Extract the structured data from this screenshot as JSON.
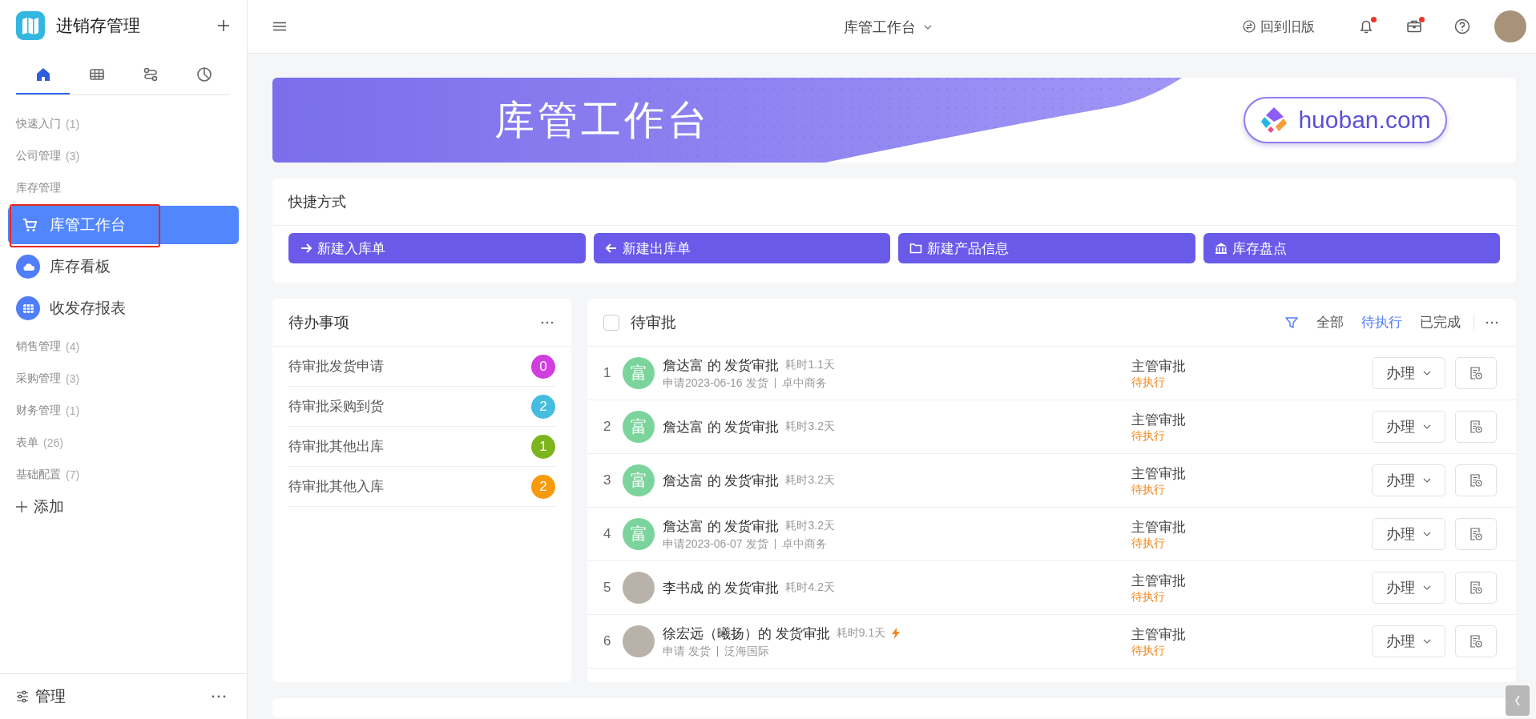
{
  "app": {
    "title": "进销存管理"
  },
  "sidebar": {
    "tabs": [
      {
        "kind": "home",
        "selected": true
      },
      {
        "kind": "table",
        "selected": false
      },
      {
        "kind": "flow",
        "selected": false
      },
      {
        "kind": "chart",
        "selected": false
      }
    ],
    "items": [
      {
        "kind": "section",
        "label": "快速入门",
        "count": "(1)"
      },
      {
        "kind": "section",
        "label": "公司管理",
        "count": "(3)"
      },
      {
        "kind": "section",
        "label": "库存管理"
      },
      {
        "kind": "app-cart",
        "label": "库管工作台",
        "selected": true,
        "highlighted": true
      },
      {
        "kind": "app-cloud",
        "label": "库存看板",
        "selected": false,
        "highlighted": false
      },
      {
        "kind": "app-grid",
        "label": "收发存报表",
        "selected": false,
        "highlighted": false
      },
      {
        "kind": "section",
        "label": "销售管理",
        "count": "(4)"
      },
      {
        "kind": "section",
        "label": "采购管理",
        "count": "(3)"
      },
      {
        "kind": "section",
        "label": "财务管理",
        "count": "(1)"
      },
      {
        "kind": "section",
        "label": "表单",
        "count": "(26)"
      },
      {
        "kind": "section",
        "label": "基础配置",
        "count": "(7)"
      }
    ],
    "add": "添加",
    "footer": "管理"
  },
  "topbar": {
    "title": "库管工作台",
    "old_version": "回到旧版",
    "notifications": [
      {
        "kind": "bell",
        "dot": true
      },
      {
        "kind": "briefcase",
        "dot": true
      },
      {
        "kind": "help"
      }
    ]
  },
  "banner": {
    "title": "库管工作台",
    "logo_text": "huoban.com"
  },
  "shortcuts": {
    "title": "快捷方式",
    "buttons": [
      {
        "kind": "arrow-right",
        "label": "新建入库单"
      },
      {
        "kind": "arrow-left",
        "label": "新建出库单"
      },
      {
        "kind": "folder",
        "label": "新建产品信息"
      },
      {
        "kind": "bank",
        "label": "库存盘点"
      }
    ]
  },
  "todo": {
    "title": "待办事项",
    "items": [
      {
        "label": "待审批发货申请",
        "count": "0",
        "color": "#d03ee0"
      },
      {
        "label": "待审批采购到货",
        "count": "2",
        "color": "#45bde0"
      },
      {
        "label": "待审批其他出库",
        "count": "1",
        "color": "#7db61c"
      },
      {
        "label": "待审批其他入库",
        "count": "2",
        "color": "#f89a0a"
      }
    ]
  },
  "approvals": {
    "title": "待审批",
    "checked": false,
    "filters": [
      {
        "label": "全部",
        "selected": false
      },
      {
        "label": "待执行",
        "selected": true
      },
      {
        "label": "已完成",
        "selected": false
      }
    ],
    "rows": [
      {
        "index": "1",
        "avatar": {
          "kind": "initial",
          "text": "富"
        },
        "title": "詹达富 的 发货审批",
        "duration": "耗时1.1天",
        "urgent": false,
        "meta": [
          "申请2023-06-16 发货",
          "卓中商务"
        ],
        "step": "主管审批",
        "status": "待执行",
        "action": "办理"
      },
      {
        "index": "2",
        "avatar": {
          "kind": "initial",
          "text": "富"
        },
        "title": "詹达富 的 发货审批",
        "duration": "耗时3.2天",
        "urgent": false,
        "meta": [],
        "step": "主管审批",
        "status": "待执行",
        "action": "办理"
      },
      {
        "index": "3",
        "avatar": {
          "kind": "initial",
          "text": "富"
        },
        "title": "詹达富 的 发货审批",
        "duration": "耗时3.2天",
        "urgent": false,
        "meta": [],
        "step": "主管审批",
        "status": "待执行",
        "action": "办理"
      },
      {
        "index": "4",
        "avatar": {
          "kind": "initial",
          "text": "富"
        },
        "title": "詹达富 的 发货审批",
        "duration": "耗时3.2天",
        "urgent": false,
        "meta": [
          "申请2023-06-07 发货",
          "卓中商务"
        ],
        "step": "主管审批",
        "status": "待执行",
        "action": "办理"
      },
      {
        "index": "5",
        "avatar": {
          "kind": "photo"
        },
        "title": "李书成 的 发货审批",
        "duration": "耗时4.2天",
        "urgent": false,
        "meta": [],
        "step": "主管审批",
        "status": "待执行",
        "action": "办理"
      },
      {
        "index": "6",
        "avatar": {
          "kind": "photo"
        },
        "title": "徐宏远（曦扬）的 发货审批",
        "duration": "耗时9.1天",
        "urgent": true,
        "meta": [
          "申请 发货",
          "泛海国际"
        ],
        "step": "主管审批",
        "status": "待执行",
        "action": "办理"
      }
    ]
  }
}
